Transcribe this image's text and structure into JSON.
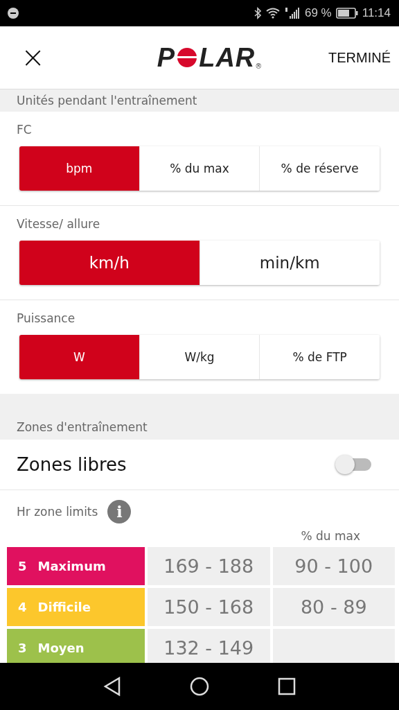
{
  "status_bar": {
    "battery_text": "69 %",
    "time": "11:14"
  },
  "header": {
    "close": "×",
    "logo": {
      "before": "P",
      "after": "LAR",
      "mark": "®"
    },
    "done": "TERMINÉ"
  },
  "units_section": {
    "title": "Unités pendant l'entraînement",
    "groups": [
      {
        "label": "FC",
        "large": false,
        "options": [
          {
            "label": "bpm",
            "selected": true
          },
          {
            "label": "% du max",
            "selected": false
          },
          {
            "label": "% de réserve",
            "selected": false
          }
        ]
      },
      {
        "label": "Vitesse/ allure",
        "large": true,
        "options": [
          {
            "label": "km/h",
            "selected": true
          },
          {
            "label": "min/km",
            "selected": false
          }
        ]
      },
      {
        "label": "Puissance",
        "large": false,
        "options": [
          {
            "label": "W",
            "selected": true
          },
          {
            "label": "W/kg",
            "selected": false
          },
          {
            "label": "% de FTP",
            "selected": false
          }
        ]
      }
    ]
  },
  "zones_section": {
    "title": "Zones d'entraînement",
    "free_zones": {
      "label": "Zones libres",
      "on": false
    },
    "limits_label": "Hr zone limits",
    "info": "i",
    "column_header": "% du max",
    "zones": [
      {
        "number": "5",
        "name": "Maximum",
        "color": "#e0115f",
        "bpm": "169 - 188",
        "pct": "90 - 100"
      },
      {
        "number": "4",
        "name": "Difficile",
        "color": "#fcc72c",
        "bpm": "150 - 168",
        "pct": "80 - 89"
      },
      {
        "number": "3",
        "name": "Moyen",
        "color": "#9dc14b",
        "bpm": "132 - 149"
      }
    ]
  }
}
